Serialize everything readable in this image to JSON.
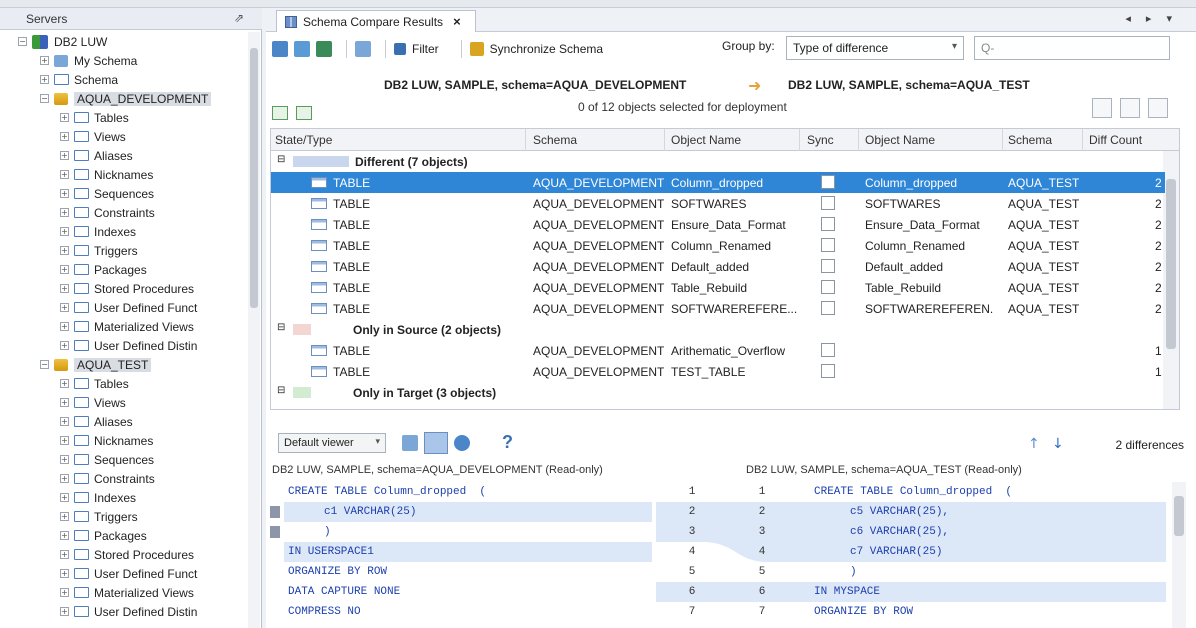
{
  "servers_panel": {
    "title": "Servers",
    "tree": [
      {
        "label": "DB2 LUW",
        "level": 0,
        "icon": "db2-server-icon"
      },
      {
        "label": "My Schema",
        "level": 1,
        "icon": "my-schema-icon"
      },
      {
        "label": "Schema",
        "level": 1,
        "icon": "folder-icon"
      },
      {
        "label": "AQUA_DEVELOPMENT",
        "level": 2,
        "icon": "schema-icon"
      },
      {
        "label": "Tables",
        "level": 3,
        "icon": "folder-icon"
      },
      {
        "label": "Views",
        "level": 3,
        "icon": "folder-icon"
      },
      {
        "label": "Aliases",
        "level": 3,
        "icon": "folder-icon"
      },
      {
        "label": "Nicknames",
        "level": 3,
        "icon": "folder-icon"
      },
      {
        "label": "Sequences",
        "level": 3,
        "icon": "folder-icon"
      },
      {
        "label": "Constraints",
        "level": 3,
        "icon": "folder-icon"
      },
      {
        "label": "Indexes",
        "level": 3,
        "icon": "folder-icon"
      },
      {
        "label": "Triggers",
        "level": 3,
        "icon": "folder-icon"
      },
      {
        "label": "Packages",
        "level": 3,
        "icon": "folder-icon"
      },
      {
        "label": "Stored Procedures",
        "level": 3,
        "icon": "folder-icon"
      },
      {
        "label": "User Defined Funct",
        "level": 3,
        "icon": "folder-icon"
      },
      {
        "label": "Materialized Views",
        "level": 3,
        "icon": "folder-icon"
      },
      {
        "label": "User Defined Distin",
        "level": 3,
        "icon": "folder-icon"
      },
      {
        "label": "AQUA_TEST",
        "level": 2,
        "icon": "schema-icon"
      },
      {
        "label": "Tables",
        "level": 3,
        "icon": "folder-icon"
      },
      {
        "label": "Views",
        "level": 3,
        "icon": "folder-icon"
      },
      {
        "label": "Aliases",
        "level": 3,
        "icon": "folder-icon"
      },
      {
        "label": "Nicknames",
        "level": 3,
        "icon": "folder-icon"
      },
      {
        "label": "Sequences",
        "level": 3,
        "icon": "folder-icon"
      },
      {
        "label": "Constraints",
        "level": 3,
        "icon": "folder-icon"
      },
      {
        "label": "Indexes",
        "level": 3,
        "icon": "folder-icon"
      },
      {
        "label": "Triggers",
        "level": 3,
        "icon": "folder-icon"
      },
      {
        "label": "Packages",
        "level": 3,
        "icon": "folder-icon"
      },
      {
        "label": "Stored Procedures",
        "level": 3,
        "icon": "folder-icon"
      },
      {
        "label": "User Defined Funct",
        "level": 3,
        "icon": "folder-icon"
      },
      {
        "label": "Materialized Views",
        "level": 3,
        "icon": "folder-icon"
      },
      {
        "label": "User Defined Distin",
        "level": 3,
        "icon": "folder-icon"
      }
    ]
  },
  "tab": {
    "label": "Schema Compare Results",
    "close": "×"
  },
  "nav_arrows": "◂ ▸ ▾",
  "toolbar": {
    "filter": "Filter",
    "sync": "Synchronize Schema",
    "group_by_label": "Group by:",
    "group_by_value": "Type of difference",
    "search_placeholder": "Q-"
  },
  "compare": {
    "source": "DB2 LUW, SAMPLE, schema=AQUA_DEVELOPMENT",
    "arrow": "➜",
    "target": "DB2 LUW, SAMPLE, schema=AQUA_TEST",
    "selection_info": "0 of 12 objects selected for deployment"
  },
  "grid": {
    "columns": [
      "State/Type",
      "Schema",
      "Object Name",
      "Sync",
      "Object Name",
      "Schema",
      "Diff Count"
    ],
    "groups": [
      {
        "label": "Different (7 objects)",
        "rows": [
          {
            "type": "TABLE",
            "src_schema": "AQUA_DEVELOPMENT",
            "src_obj": "Column_dropped",
            "tgt_obj": "Column_dropped",
            "tgt_schema": "AQUA_TEST",
            "diff": "2",
            "selected": true
          },
          {
            "type": "TABLE",
            "src_schema": "AQUA_DEVELOPMENT",
            "src_obj": "SOFTWARES",
            "tgt_obj": "SOFTWARES",
            "tgt_schema": "AQUA_TEST",
            "diff": "2"
          },
          {
            "type": "TABLE",
            "src_schema": "AQUA_DEVELOPMENT",
            "src_obj": "Ensure_Data_Format",
            "tgt_obj": "Ensure_Data_Format",
            "tgt_schema": "AQUA_TEST",
            "diff": "2"
          },
          {
            "type": "TABLE",
            "src_schema": "AQUA_DEVELOPMENT",
            "src_obj": "Column_Renamed",
            "tgt_obj": "Column_Renamed",
            "tgt_schema": "AQUA_TEST",
            "diff": "2"
          },
          {
            "type": "TABLE",
            "src_schema": "AQUA_DEVELOPMENT",
            "src_obj": "Default_added",
            "tgt_obj": "Default_added",
            "tgt_schema": "AQUA_TEST",
            "diff": "2"
          },
          {
            "type": "TABLE",
            "src_schema": "AQUA_DEVELOPMENT",
            "src_obj": "Table_Rebuild",
            "tgt_obj": "Table_Rebuild",
            "tgt_schema": "AQUA_TEST",
            "diff": "2"
          },
          {
            "type": "TABLE",
            "src_schema": "AQUA_DEVELOPMENT",
            "src_obj": "SOFTWAREREFERE...",
            "tgt_obj": "SOFTWAREREFEREN...",
            "tgt_schema": "AQUA_TEST",
            "diff": "2"
          }
        ]
      },
      {
        "label": "Only in Source (2 objects)",
        "rows": [
          {
            "type": "TABLE",
            "src_schema": "AQUA_DEVELOPMENT",
            "src_obj": "Arithematic_Overflow",
            "tgt_obj": "",
            "tgt_schema": "",
            "diff": "1"
          },
          {
            "type": "TABLE",
            "src_schema": "AQUA_DEVELOPMENT",
            "src_obj": "TEST_TABLE",
            "tgt_obj": "",
            "tgt_schema": "",
            "diff": "1"
          }
        ]
      },
      {
        "label": "Only in Target (3 objects)",
        "rows": []
      }
    ]
  },
  "viewer": {
    "mode": "Default viewer",
    "help": "?",
    "diff_count": "2 differences",
    "left_header": "DB2 LUW, SAMPLE, schema=AQUA_DEVELOPMENT (Read-only)",
    "right_header": "DB2 LUW, SAMPLE, schema=AQUA_TEST (Read-only)",
    "left_lines": [
      "CREATE TABLE Column_dropped  (",
      "c1 VARCHAR(25)",
      ")",
      "IN USERSPACE1",
      "ORGANIZE BY ROW",
      "DATA CAPTURE NONE",
      "COMPRESS NO"
    ],
    "left_nums": [
      "1",
      "2",
      "3",
      "4",
      "5",
      "6",
      "7"
    ],
    "right_nums": [
      "1",
      "2",
      "3",
      "4",
      "5",
      "6",
      "7"
    ],
    "right_lines": [
      "CREATE TABLE Column_dropped  (",
      "c5 VARCHAR(25),",
      "c6 VARCHAR(25),",
      "c7 VARCHAR(25)",
      ")",
      "IN MYSPACE",
      "ORGANIZE BY ROW"
    ]
  },
  "colors": {
    "selection": "#2f86d6",
    "diff_highlight": "#dce7f7",
    "code_blue": "#1c3fae"
  }
}
